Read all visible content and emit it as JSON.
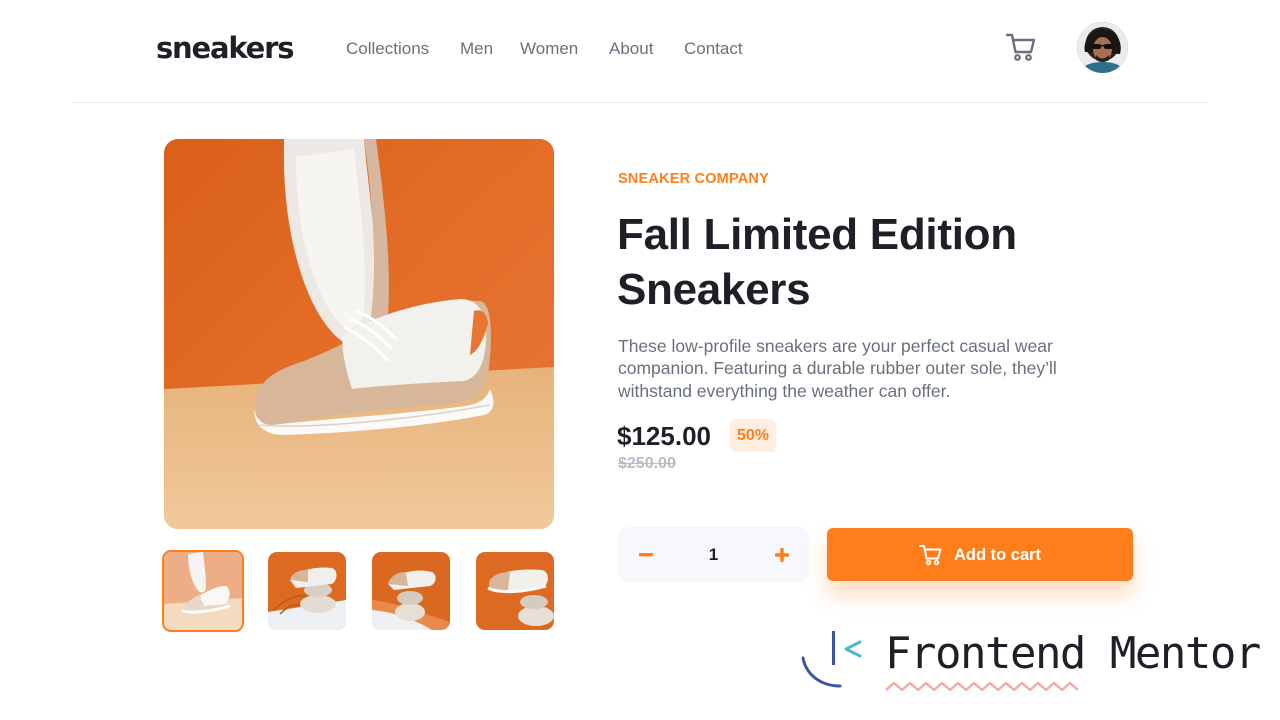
{
  "brand": {
    "logo_text": "sneakers"
  },
  "nav": {
    "items": [
      "Collections",
      "Men",
      "Women",
      "About",
      "Contact"
    ]
  },
  "header": {
    "cart_icon": "cart-icon",
    "avatar_icon": "user-avatar"
  },
  "gallery": {
    "thumbnails": [
      "thumbnail-1",
      "thumbnail-2",
      "thumbnail-3",
      "thumbnail-4"
    ],
    "selected_index": 0
  },
  "product": {
    "company": "SNEAKER COMPANY",
    "title": "Fall Limited Edition Sneakers",
    "description": "These low-profile sneakers are your perfect casual wear companion. Featuring a durable rubber outer sole, they’ll withstand everything the weather can offer.",
    "price": "$125.00",
    "discount": "50%",
    "old_price": "$250.00"
  },
  "cart_controls": {
    "quantity": "1",
    "minus_icon": "minus-icon",
    "plus_icon": "plus-icon",
    "add_to_cart_label": "Add to cart"
  },
  "watermark": {
    "text": "Frontend Mentor"
  },
  "colors": {
    "accent": "#ff7e1b",
    "accent_pale": "#ffede0",
    "text_dark": "#1d2026",
    "text_muted": "#69707d",
    "text_light": "#b6bcc8",
    "qty_background": "#f6f8fd"
  }
}
